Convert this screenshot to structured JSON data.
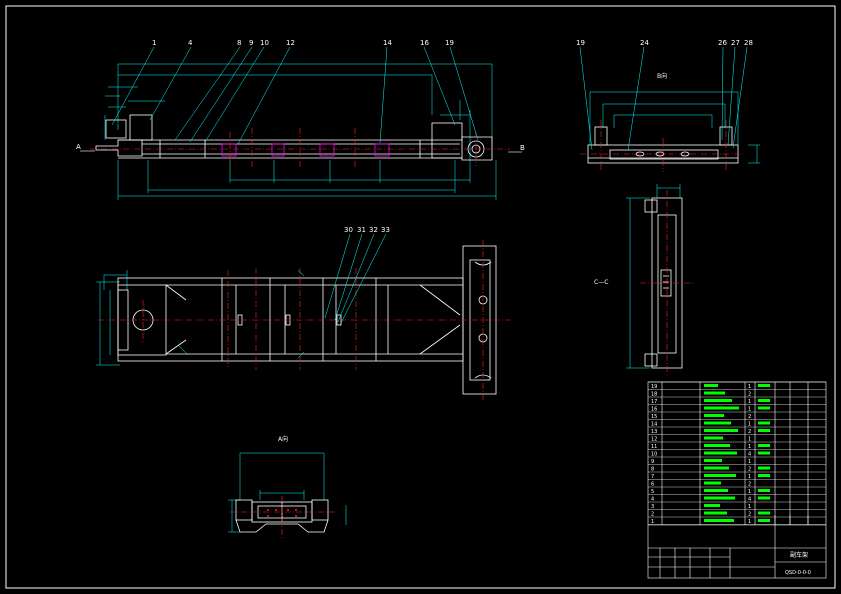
{
  "title_block": {
    "name": "副车架",
    "code": "QSD-0-0-0"
  },
  "view_labels": {
    "a_view": "A向",
    "b_view": "B向",
    "c_section": "C—C",
    "arrow_a": "A",
    "arrow_b": "B"
  },
  "callouts": {
    "front_view": [
      "1",
      "4",
      "8",
      "9",
      "10",
      "12",
      "14",
      "16",
      "19"
    ],
    "side_view": [
      "19",
      "24",
      "26",
      "27",
      "28"
    ],
    "plan_view": [
      "30",
      "31",
      "32",
      "33"
    ]
  },
  "parts_list": {
    "item_numbers": [
      "19",
      "18",
      "17",
      "16",
      "15",
      "14",
      "13",
      "12",
      "11",
      "10",
      "9",
      "8",
      "7",
      "6",
      "5",
      "4",
      "3",
      "2",
      "1"
    ],
    "quantities": [
      "1",
      "2",
      "1",
      "1",
      "2",
      "1",
      "2",
      "1",
      "1",
      "4",
      "1",
      "2",
      "1",
      "2",
      "1",
      "4",
      "1",
      "2",
      "1"
    ]
  },
  "colors": {
    "background": "#000000",
    "outline": "#ffffff",
    "dimension": "#00ffff",
    "centerline": "#ff2020",
    "leader": "#00ffff",
    "table_text": "#00ff00",
    "hidden": "#ff00ff",
    "frame": "#ffffff"
  }
}
